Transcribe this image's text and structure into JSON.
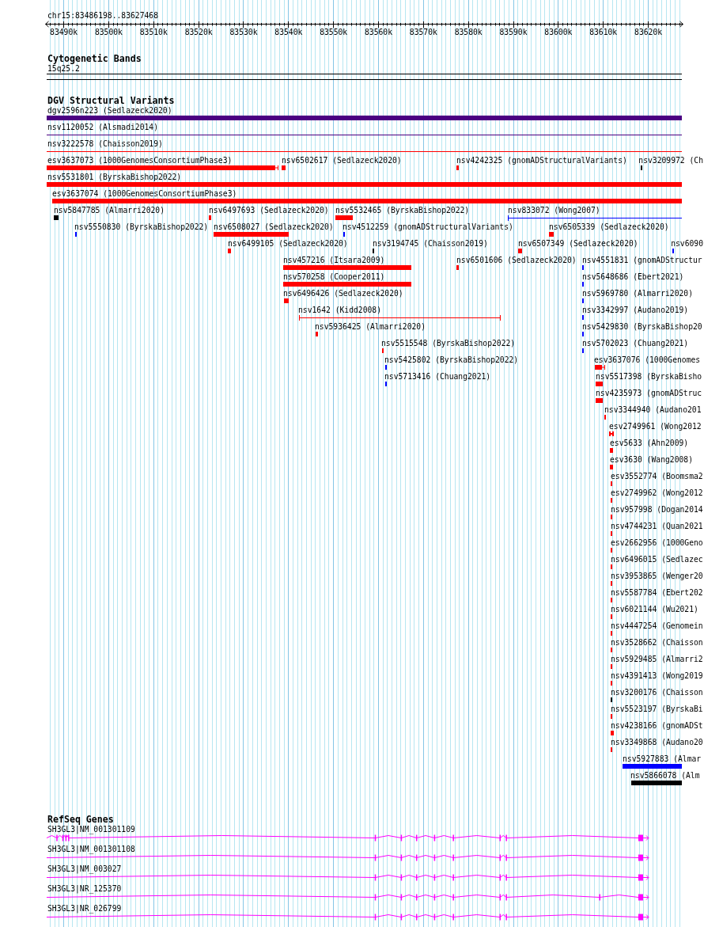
{
  "ruler": {
    "location": "chr15:83486198..83627468",
    "tick_labels": [
      "83490k",
      "83500k",
      "83510k",
      "83520k",
      "83530k",
      "83540k",
      "83550k",
      "83560k",
      "83570k",
      "83580k",
      "83590k",
      "83600k",
      "83610k",
      "83620k"
    ]
  },
  "cytogenetic_bands": {
    "title": "Cytogenetic Bands",
    "bands": [
      {
        "label": "15q25.2"
      }
    ]
  },
  "dgv_structural_variants": {
    "title": "DGV Structural Variants",
    "variants": [
      {
        "label": "dgv2596n223 (Sedlazeck2020)",
        "kind": "bar",
        "color": "#4b0082"
      },
      {
        "label": "nsv1120052 (Alsmadi2014)",
        "kind": "line",
        "color": "#4b0082"
      },
      {
        "label": "nsv3222578 (Chaisson2019)",
        "kind": "line",
        "color": "#ff0000"
      },
      {
        "label": "esv3637073 (1000GenomesConsortiumPhase3)",
        "kind": "bar",
        "color": "#ff0000"
      },
      {
        "label": "nsv6502617 (Sedlazeck2020)",
        "kind": "bar",
        "color": "#ff0000"
      },
      {
        "label": "nsv4242325 (gnomADStructuralVariants)",
        "kind": "bar",
        "color": "#ff0000"
      },
      {
        "label": "nsv3209972 (Ch",
        "kind": "bar",
        "color": "#000000"
      },
      {
        "label": "nsv5531801 (ByrskaBishop2022)",
        "kind": "bar",
        "color": "#ff0000"
      },
      {
        "label": "esv3637074 (1000GenomesConsortiumPhase3)",
        "kind": "bar",
        "color": "#ff0000"
      },
      {
        "label": "nsv5847785 (Almarri2020)",
        "kind": "bar",
        "color": "#000000"
      },
      {
        "label": "nsv6497693 (Sedlazeck2020)",
        "kind": "bar",
        "color": "#ff0000"
      },
      {
        "label": "nsv5532465 (ByrskaBishop2022)",
        "kind": "bar",
        "color": "#ff0000"
      },
      {
        "label": "nsv833072 (Wong2007)",
        "kind": "line",
        "color": "#0000ff"
      },
      {
        "label": "nsv5550830 (ByrskaBishop2022)",
        "kind": "bar",
        "color": "#0000ff"
      },
      {
        "label": "nsv6508027 (Sedlazeck2020)",
        "kind": "bar",
        "color": "#ff0000"
      },
      {
        "label": "nsv4512259 (gnomADStructuralVariants)",
        "kind": "bar",
        "color": "#0000ff"
      },
      {
        "label": "nsv6505339 (Sedlazeck2020)",
        "kind": "bar",
        "color": "#ff0000"
      },
      {
        "label": "nsv6499105 (Sedlazeck2020)",
        "kind": "bar",
        "color": "#ff0000"
      },
      {
        "label": "nsv3194745 (Chaisson2019)",
        "kind": "bar",
        "color": "#000000"
      },
      {
        "label": "nsv6507349 (Sedlazeck2020)",
        "kind": "bar",
        "color": "#ff0000"
      },
      {
        "label": "nsv6090",
        "kind": "bar",
        "color": "#0000ff"
      },
      {
        "label": "nsv457216 (Itsara2009)",
        "kind": "bar",
        "color": "#ff0000"
      },
      {
        "label": "nsv6501606 (Sedlazeck2020)",
        "kind": "bar",
        "color": "#ff0000"
      },
      {
        "label": "nsv4551831 (gnomADStructur",
        "kind": "bar",
        "color": "#0000ff"
      },
      {
        "label": "nsv570258 (Cooper2011)",
        "kind": "bar",
        "color": "#ff0000"
      },
      {
        "label": "nsv5648686 (Ebert2021)",
        "kind": "bar",
        "color": "#0000ff"
      },
      {
        "label": "nsv6496426 (Sedlazeck2020)",
        "kind": "bar",
        "color": "#ff0000"
      },
      {
        "label": "nsv5969780 (Almarri2020)",
        "kind": "bar",
        "color": "#0000ff"
      },
      {
        "label": "nsv1642 (Kidd2008)",
        "kind": "line",
        "color": "#ff0000"
      },
      {
        "label": "nsv3342997 (Audano2019)",
        "kind": "bar",
        "color": "#0000ff"
      },
      {
        "label": "nsv5936425 (Almarri2020)",
        "kind": "bar",
        "color": "#ff0000"
      },
      {
        "label": "nsv5429830 (ByrskaBishop20",
        "kind": "bar",
        "color": "#0000ff"
      },
      {
        "label": "nsv5515548 (ByrskaBishop2022)",
        "kind": "bar",
        "color": "#ff0000"
      },
      {
        "label": "nsv5702023 (Chuang2021)",
        "kind": "bar",
        "color": "#0000ff"
      },
      {
        "label": "nsv5425802 (ByrskaBishop2022)",
        "kind": "bar",
        "color": "#0000ff"
      },
      {
        "label": "esv3637076 (1000Genomes",
        "kind": "bar",
        "color": "#ff0000"
      },
      {
        "label": "nsv5713416 (Chuang2021)",
        "kind": "bar",
        "color": "#0000ff"
      },
      {
        "label": "nsv5517398 (ByrskaBisho",
        "kind": "bar",
        "color": "#ff0000"
      },
      {
        "label": "nsv4235973 (gnomADStruc",
        "kind": "bar",
        "color": "#ff0000"
      },
      {
        "label": "nsv3344940 (Audano201",
        "kind": "bar",
        "color": "#ff0000"
      },
      {
        "label": "esv2749961 (Wong2012",
        "kind": "bar",
        "color": "#ff0000"
      },
      {
        "label": "esv5633 (Ahn2009)",
        "kind": "bar",
        "color": "#ff0000"
      },
      {
        "label": "esv3630 (Wang2008)",
        "kind": "bar",
        "color": "#ff0000"
      },
      {
        "label": "esv3552774 (Boomsma2",
        "kind": "bar",
        "color": "#ff0000"
      },
      {
        "label": "esv2749962 (Wong2012",
        "kind": "bar",
        "color": "#ff0000"
      },
      {
        "label": "nsv957998 (Dogan2014",
        "kind": "bar",
        "color": "#ff0000"
      },
      {
        "label": "nsv4744231 (Quan2021",
        "kind": "bar",
        "color": "#ff0000"
      },
      {
        "label": "esv2662956 (1000Geno",
        "kind": "bar",
        "color": "#ff0000"
      },
      {
        "label": "nsv6496015 (Sedlazec",
        "kind": "bar",
        "color": "#ff0000"
      },
      {
        "label": "nsv3953865 (Wenger20",
        "kind": "bar",
        "color": "#ff0000"
      },
      {
        "label": "nsv5587784 (Ebert202",
        "kind": "bar",
        "color": "#ff0000"
      },
      {
        "label": "nsv6021144 (Wu2021)",
        "kind": "bar",
        "color": "#ff0000"
      },
      {
        "label": "nsv4447254 (Genomein",
        "kind": "bar",
        "color": "#ff0000"
      },
      {
        "label": "nsv3528662 (Chaisson",
        "kind": "bar",
        "color": "#ff0000"
      },
      {
        "label": "nsv5929485 (Almarri2",
        "kind": "bar",
        "color": "#ff0000"
      },
      {
        "label": "nsv4391413 (Wong2019",
        "kind": "bar",
        "color": "#ff0000"
      },
      {
        "label": "nsv3200176 (Chaisson",
        "kind": "bar",
        "color": "#000000"
      },
      {
        "label": "nsv5523197 (ByrskaBi",
        "kind": "bar",
        "color": "#ff0000"
      },
      {
        "label": "nsv4238166 (gnomADSt",
        "kind": "bar",
        "color": "#ff0000"
      },
      {
        "label": "nsv3349868 (Audano20",
        "kind": "bar",
        "color": "#ff0000"
      },
      {
        "label": "nsv5927883 (Almar",
        "kind": "bar",
        "color": "#0000ff"
      },
      {
        "label": "nsv5866078 (Alm",
        "kind": "bar",
        "color": "#000000"
      }
    ]
  },
  "refseq_genes": {
    "title": "RefSeq Genes",
    "transcripts": [
      {
        "label": "SH3GL3|NM_001301109"
      },
      {
        "label": "SH3GL3|NM_001301108"
      },
      {
        "label": "SH3GL3|NM_003027"
      },
      {
        "label": "SH3GL3|NR_125370"
      },
      {
        "label": "SH3GL3|NR_026799"
      }
    ]
  }
}
